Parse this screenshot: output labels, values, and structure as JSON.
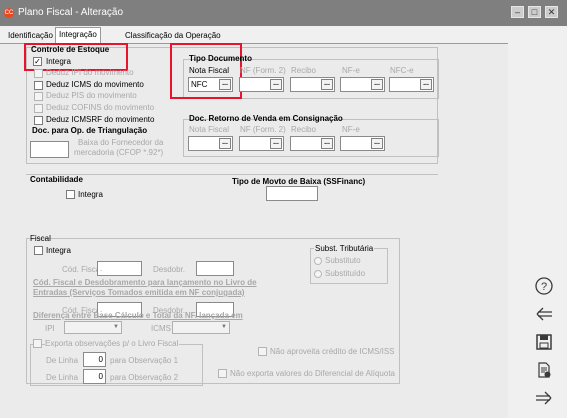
{
  "window": {
    "title": "Plano Fiscal - Alteração",
    "app_icon": "CC",
    "minimize": "–",
    "maximize": "□",
    "close": "✕"
  },
  "tabs": [
    {
      "label": "Identificação"
    },
    {
      "label": "Integração"
    },
    {
      "label": "Classificação da Operação"
    }
  ],
  "estoque": {
    "title": "Controle de Estoque",
    "integra": "Integra",
    "items": [
      "Deduz IPI do movimento",
      "Deduz ICMS do movimento",
      "Deduz PIS do movimento",
      "Deduz COFINS do movimento",
      "Deduz ICMSRF do movimento"
    ],
    "triang_title": "Doc. para Op. de Triangulação",
    "triang_label1": "Baixa do Fornecedor da",
    "triang_label2": "mercadoria  (CFOP *.92*)"
  },
  "tipo_doc": {
    "title": "Tipo Documento",
    "cols": [
      "Nota Fiscal",
      "NF (Form. 2)",
      "Recibo",
      "NF-e",
      "NFC-e"
    ],
    "nota_fiscal_value": "NFC",
    "ellipsis": "..."
  },
  "retorno": {
    "title": "Doc. Retorno de Venda em Consignação",
    "cols": [
      "Nota Fiscal",
      "NF (Form. 2)",
      "Recibo",
      "NF-e"
    ]
  },
  "contabilidade": {
    "title": "Contabilidade",
    "integra": "Integra"
  },
  "movto_baixa": {
    "title": "Tipo de Movto de Baixa (SSFinanc)"
  },
  "fiscal": {
    "title": "Fiscal",
    "integra": "Integra",
    "cod_fiscal": "Cód. Fiscal",
    "cod_fiscal_value": ".",
    "desdobr": "Desdobr.",
    "cod_desdobr_title1": "Cód. Fiscal e Desdobramento para lançamento no Livro de",
    "cod_desdobr_title2": "Entradas (Serviços Tomados emitida em NF conjugada)",
    "cod_fiscal2": "Cód. Fiscal",
    "cod_fiscal2_value": ".",
    "desdobr2": "Desdobr.",
    "diferenca_title": "Diferença entre Base Cálculo e Total da NF. lançada em",
    "ipi": "IPI",
    "icms": "ICMS",
    "subst_title": "Subst. Tributária",
    "substituto": "Substituto",
    "substituido": "Substituído",
    "exporta_obs": "Exporta observações p/ o Livro Fiscal",
    "de_linha": "De Linha",
    "linha1_value": "0",
    "para_obs1": "para Observação 1",
    "linha2_value": "0",
    "para_obs2": "para Observação 2",
    "nao_aproveita": "Não aproveita crédito de ICMS/ISS",
    "nao_exporta": "Não exporta valores do Diferencial de Alíquota"
  },
  "sidebar": {
    "help": "?",
    "back": "⇐",
    "save": "save",
    "report": "report",
    "forward": "⇒"
  }
}
